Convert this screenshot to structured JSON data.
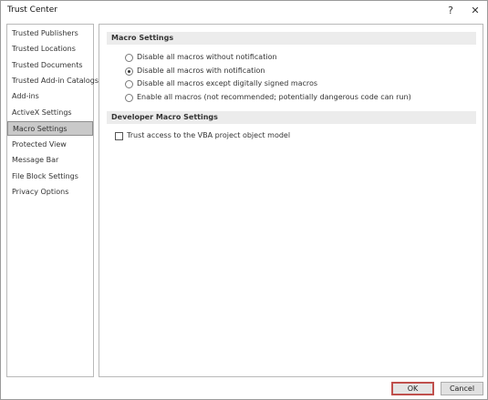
{
  "window": {
    "title": "Trust Center",
    "help_glyph": "?",
    "close_glyph": "✕"
  },
  "sidebar": {
    "items": [
      {
        "label": "Trusted Publishers",
        "selected": false
      },
      {
        "label": "Trusted Locations",
        "selected": false
      },
      {
        "label": "Trusted Documents",
        "selected": false
      },
      {
        "label": "Trusted Add-in Catalogs",
        "selected": false
      },
      {
        "label": "Add-ins",
        "selected": false
      },
      {
        "label": "ActiveX Settings",
        "selected": false
      },
      {
        "label": "Macro Settings",
        "selected": true
      },
      {
        "label": "Protected View",
        "selected": false
      },
      {
        "label": "Message Bar",
        "selected": false
      },
      {
        "label": "File Block Settings",
        "selected": false
      },
      {
        "label": "Privacy Options",
        "selected": false
      }
    ]
  },
  "macro_settings": {
    "header": "Macro Settings",
    "options": [
      {
        "label": "Disable all macros without notification",
        "checked": false
      },
      {
        "label": "Disable all macros with notification",
        "checked": true
      },
      {
        "label": "Disable all macros except digitally signed macros",
        "checked": false
      },
      {
        "label": "Enable all macros (not recommended; potentially dangerous code can run)",
        "checked": false
      }
    ]
  },
  "developer_macro_settings": {
    "header": "Developer Macro Settings",
    "trust_vba_label": "Trust access to the VBA project object model",
    "trust_vba_checked": false
  },
  "buttons": {
    "ok_label": "OK",
    "cancel_label": "Cancel"
  }
}
